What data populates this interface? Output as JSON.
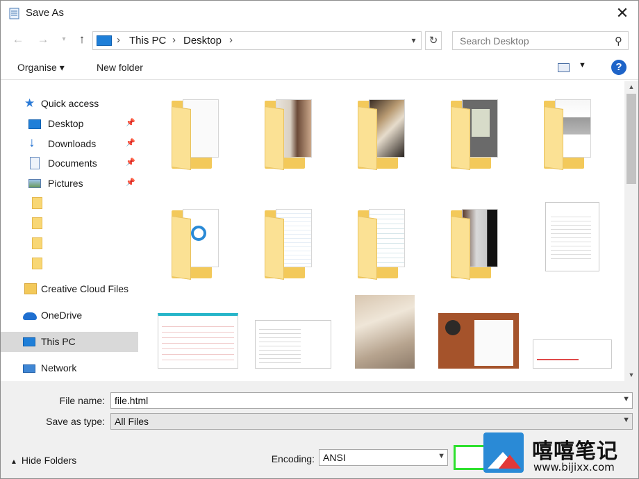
{
  "window": {
    "title": "Save As",
    "close_label": "✕"
  },
  "address": {
    "crumbs": [
      "This PC",
      "Desktop"
    ]
  },
  "search": {
    "placeholder": "Search Desktop"
  },
  "toolbar": {
    "organise_label": "Organise ▾",
    "new_folder_label": "New folder",
    "help_label": "?"
  },
  "sidebar": {
    "items": [
      {
        "label": "Quick access",
        "icon": "star-icon"
      },
      {
        "label": "Desktop",
        "icon": "desktop-icon",
        "pinned": true
      },
      {
        "label": "Downloads",
        "icon": "download-icon",
        "pinned": true
      },
      {
        "label": "Documents",
        "icon": "documents-icon",
        "pinned": true
      },
      {
        "label": "Pictures",
        "icon": "pictures-icon",
        "pinned": true
      },
      {
        "label": "Creative Cloud Files",
        "icon": "creative-cloud-icon"
      },
      {
        "label": "OneDrive",
        "icon": "onedrive-icon"
      },
      {
        "label": "This PC",
        "icon": "pc-icon",
        "selected": true
      },
      {
        "label": "Network",
        "icon": "network-icon"
      }
    ]
  },
  "form": {
    "file_name_label": "File name:",
    "file_name_value": "file.html",
    "save_type_label": "Save as type:",
    "save_type_value": "All Files",
    "encoding_label": "Encoding:",
    "encoding_value": "ANSI",
    "hide_folders_label": "Hide Folders"
  },
  "watermark": {
    "brand": "嘻嘻笔记",
    "url": "www.bijixx.com"
  },
  "colors": {
    "accent": "#1e64c8",
    "selected_bg": "#d9d9d9",
    "save_highlight": "#2ee02e",
    "folder": "#f3c95a"
  }
}
